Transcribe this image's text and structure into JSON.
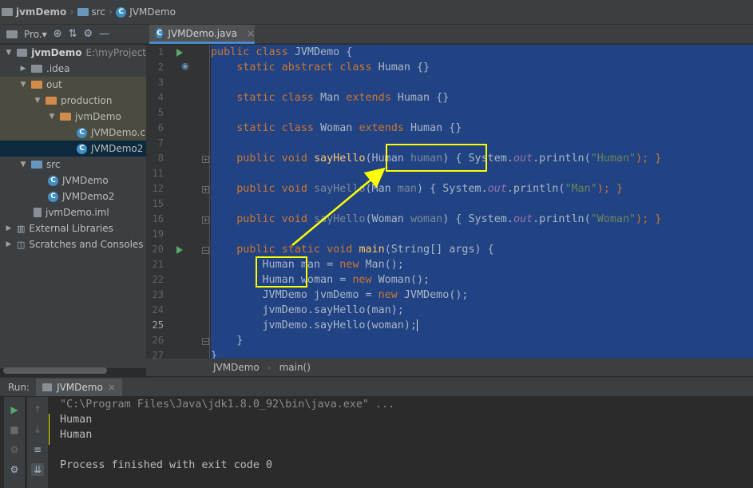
{
  "navbar": {
    "project": "jvmDemo",
    "folder": "src",
    "file": "JVMDemo"
  },
  "project_toolbar": {
    "label": "Pro.▾"
  },
  "tabs": [
    {
      "label": "JVMDemo.java",
      "close": "×"
    }
  ],
  "tree": {
    "root": {
      "label": "jvmDemo",
      "path": "E:\\myProject"
    },
    "idea": ".idea",
    "out": "out",
    "production": "production",
    "jvmDemo_folder": "jvmDemo",
    "file1": "JVMDemo.c",
    "file2": "JVMDemo2",
    "src": "src",
    "src_file1": "JVMDemo",
    "src_file2": "JVMDemo2",
    "iml": "jvmDemo.iml",
    "ext": "External Libraries",
    "scratches": "Scratches and Consoles"
  },
  "editor": {
    "line_numbers": [
      "1",
      "2",
      "3",
      "4",
      "5",
      "6",
      "7",
      "8",
      "11",
      "12",
      "15",
      "16",
      "19",
      "20",
      "21",
      "22",
      "23",
      "24",
      "25",
      "26",
      "27"
    ],
    "code": {
      "l1a": "public class ",
      "l1b": "JVMDemo {",
      "l2a": "    static abstract class ",
      "l2b": "Human {}",
      "l4a": "    static class ",
      "l4b": "Man ",
      "l4c": "extends ",
      "l4d": "Human {}",
      "l6a": "    static class ",
      "l6b": "Woman ",
      "l6c": "extends ",
      "l6d": "Human {}",
      "l8a": "    public void ",
      "l8b": "sayHello",
      "l8c": "(Human ",
      "l8d": "human",
      "l8e": ") { System.",
      "l8f": "out",
      "l8g": ".println(",
      "l8h": "\"Human\"",
      "l8i": "); }",
      "l12a": "    public void ",
      "l12b": "sayHello",
      "l12c": "(Man ",
      "l12d": "man",
      "l12e": ") { System.",
      "l12f": "out",
      "l12g": ".println(",
      "l12h": "\"Man\"",
      "l12i": "); }",
      "l16a": "    public void ",
      "l16b": "sayHello",
      "l16c": "(Woman ",
      "l16d": "woman",
      "l16e": ") { System.",
      "l16f": "out",
      "l16g": ".println(",
      "l16h": "\"Woman\"",
      "l16i": "); }",
      "l20a": "    public static void ",
      "l20b": "main",
      "l20c": "(String[] args) {",
      "l21a": "        Human man = ",
      "l21b": "new ",
      "l21c": "Man();",
      "l22a": "        Human woman = ",
      "l22b": "new ",
      "l22c": "Woman();",
      "l23a": "        JVMDemo jvmDemo = ",
      "l23b": "new ",
      "l23c": "JVMDemo();",
      "l24": "        jvmDemo.sayHello(man);",
      "l25": "        jvmDemo.sayHello(woman);",
      "l26": "    }",
      "l27": "}"
    }
  },
  "breadcrumb": {
    "class": "JVMDemo",
    "method": "main()"
  },
  "run": {
    "label": "Run:",
    "tab": "JVMDemo"
  },
  "console": {
    "command": "\"C:\\Program Files\\Java\\jdk1.8.0_92\\bin\\java.exe\" ...",
    "out1": "Human",
    "out2": "Human",
    "exit": "Process finished with exit code 0"
  },
  "colors": {
    "selection": "#214283",
    "highlight_box": "#ffff00",
    "arrow": "#ffff00"
  }
}
